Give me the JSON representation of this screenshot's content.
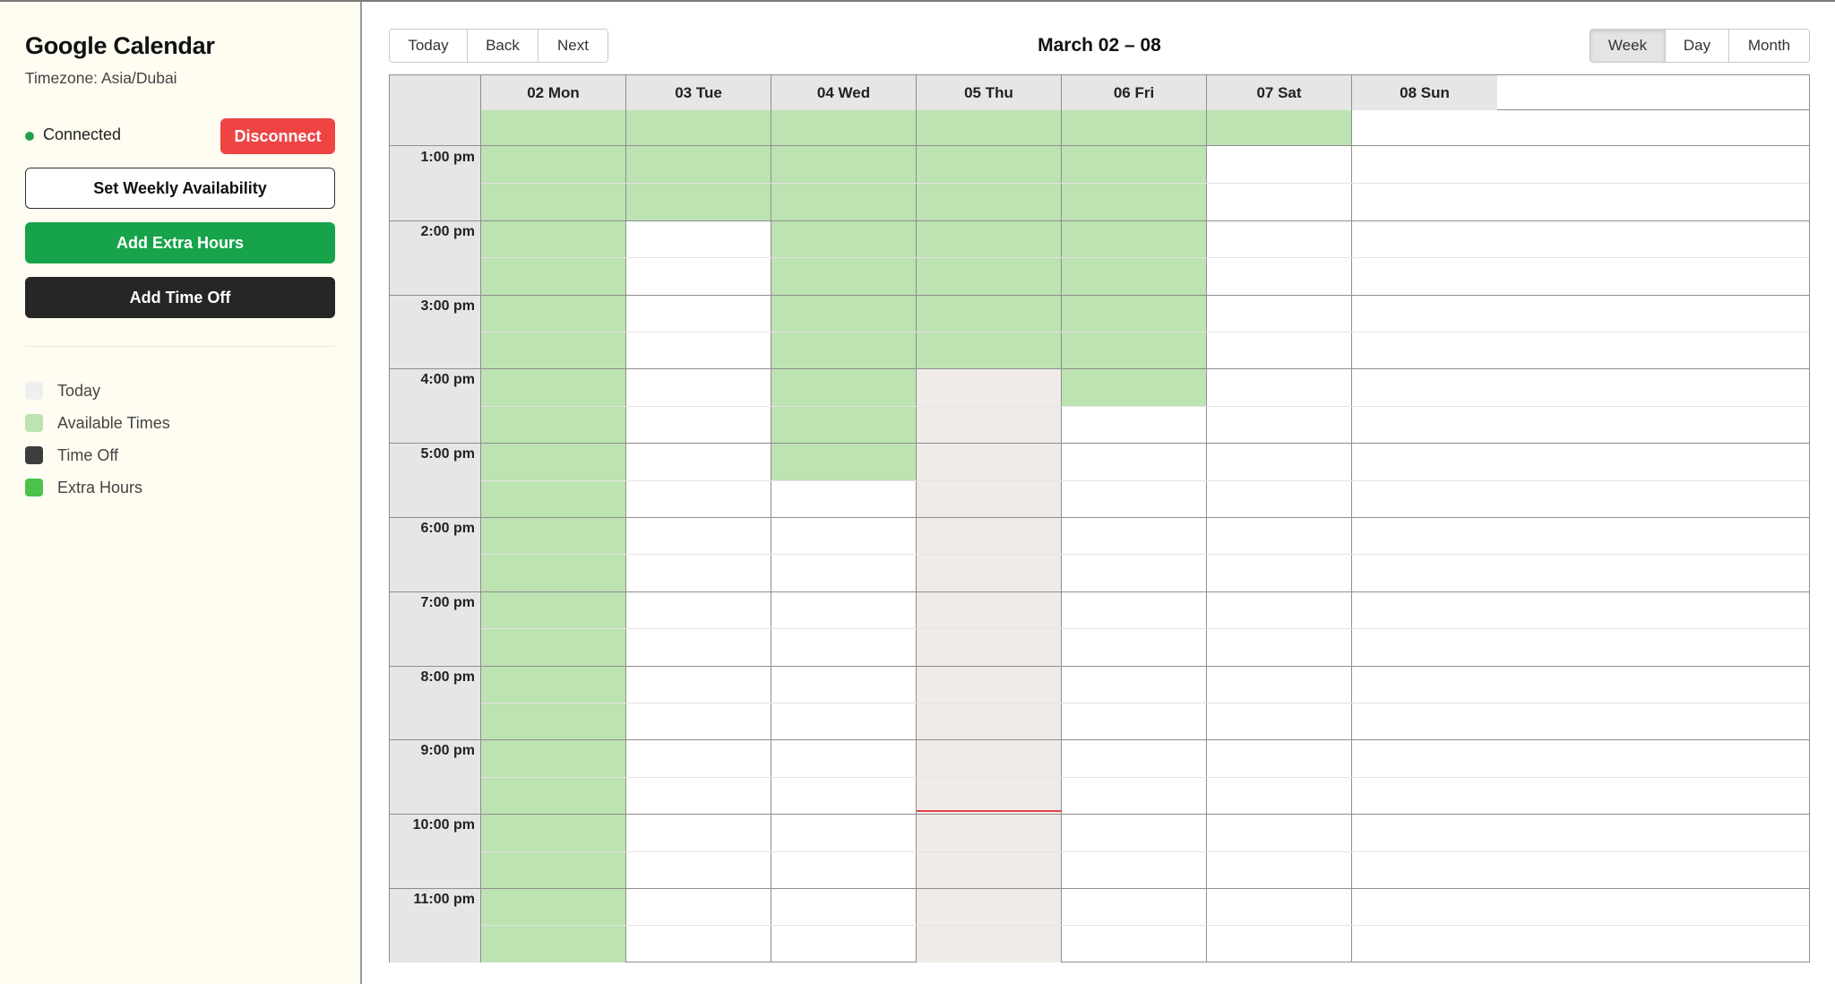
{
  "sidebar": {
    "title": "Google Calendar",
    "timezone": "Timezone: Asia/Dubai",
    "status": "Connected",
    "disconnect_label": "Disconnect",
    "weekly_label": "Set Weekly Availability",
    "extra_label": "Add Extra Hours",
    "timeoff_label": "Add Time Off",
    "legend": [
      {
        "label": "Today",
        "color": "#efefef",
        "icon": "today-swatch"
      },
      {
        "label": "Available Times",
        "color": "#bde3b3",
        "icon": "available-swatch"
      },
      {
        "label": "Time Off",
        "color": "#3d3d3d",
        "icon": "timeoff-swatch"
      },
      {
        "label": "Extra Hours",
        "color": "#4cc24a",
        "icon": "extra-swatch"
      }
    ]
  },
  "toolbar": {
    "today_label": "Today",
    "back_label": "Back",
    "next_label": "Next",
    "range_title": "March 02 – 08",
    "views": [
      {
        "label": "Week",
        "active": true
      },
      {
        "label": "Day",
        "active": false
      },
      {
        "label": "Month",
        "active": false
      }
    ]
  },
  "calendar": {
    "days": [
      "02 Mon",
      "03 Tue",
      "04 Wed",
      "05 Thu",
      "06 Fri",
      "07 Sat",
      "08 Sun"
    ],
    "hours": [
      "1:00 pm",
      "2:00 pm",
      "3:00 pm",
      "4:00 pm",
      "5:00 pm",
      "6:00 pm",
      "7:00 pm",
      "8:00 pm",
      "9:00 pm",
      "10:00 pm",
      "11:00 pm"
    ],
    "today_index": 3,
    "now_time": 21.95,
    "colors": {
      "available": "#bde3b3",
      "today": "#f0ebe6",
      "now_line": "#e5484d"
    },
    "top_row_available": [
      true,
      true,
      true,
      true,
      true,
      true,
      false
    ],
    "availability": [
      [
        {
          "start": 13,
          "end": 24
        }
      ],
      [
        {
          "start": 13,
          "end": 14
        }
      ],
      [
        {
          "start": 13,
          "end": 17.5
        }
      ],
      [
        {
          "start": 13,
          "end": 16
        }
      ],
      [
        {
          "start": 13,
          "end": 16.5
        }
      ],
      [],
      []
    ]
  }
}
